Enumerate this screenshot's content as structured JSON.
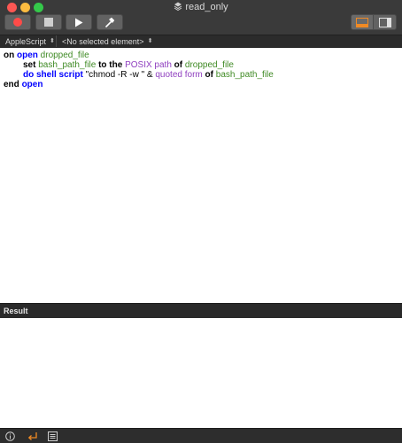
{
  "window": {
    "title": "read_only"
  },
  "toolbar": {
    "buttons": [
      {
        "name": "record-button",
        "icon": "record-icon"
      },
      {
        "name": "stop-button",
        "icon": "stop-icon"
      },
      {
        "name": "run-button",
        "icon": "play-icon"
      },
      {
        "name": "compile-button",
        "icon": "hammer-icon"
      }
    ],
    "view_toggles": [
      "show-bottom-pane-icon",
      "show-sidebar-icon"
    ],
    "accent_color": "#f08a24"
  },
  "navbar": {
    "language": "AppleScript",
    "element": "<No selected element>"
  },
  "script": {
    "line1": {
      "t1": "on",
      "t2": "open",
      "t3": "dropped_file"
    },
    "line2": {
      "t1": "set",
      "t2": "bash_path_file",
      "t3": "to the",
      "t4": "POSIX path",
      "t5": "of",
      "t6": "dropped_file"
    },
    "line3": {
      "t1": "do shell script",
      "t2": "\"chmod -R -w \"",
      "t3": "&",
      "t4": "quoted form",
      "t5": "of",
      "t6": "bash_path_file"
    },
    "line4": {
      "t1": "end",
      "t2": "open"
    }
  },
  "result": {
    "label": "Result"
  },
  "bottombar": {
    "icons": [
      "info-icon",
      "reply-arrow-icon",
      "log-list-icon"
    ]
  }
}
